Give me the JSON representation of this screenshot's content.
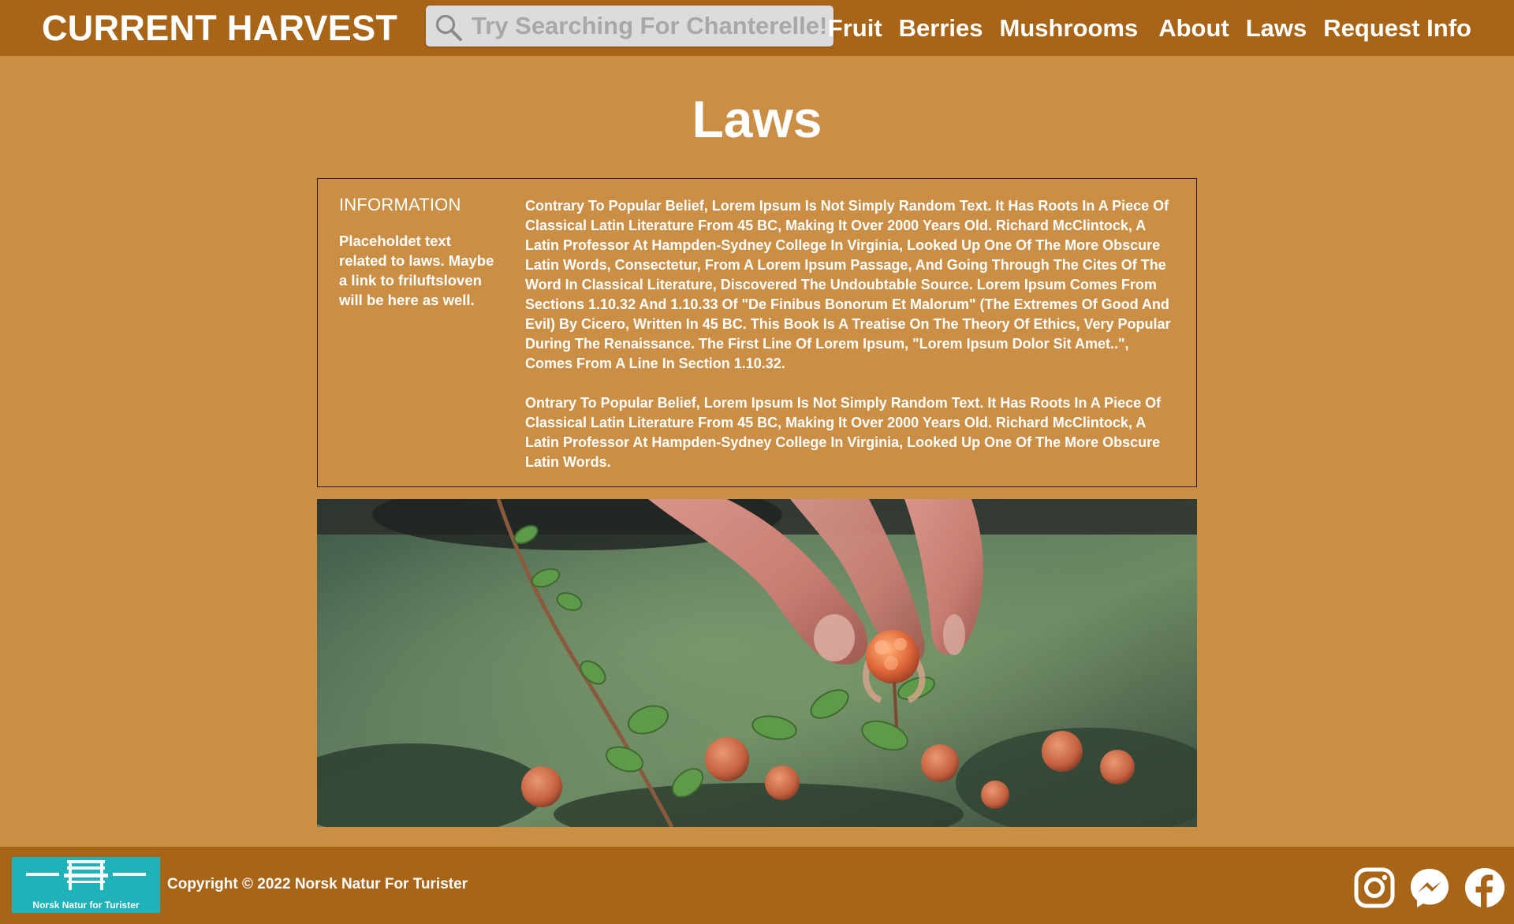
{
  "header": {
    "brand": "CURRENT HARVEST",
    "search": {
      "placeholder": "Try Searching For Chanterelle!",
      "value": ""
    },
    "nav": [
      {
        "label": "Fruit"
      },
      {
        "label": "Berries"
      },
      {
        "label": "Mushrooms"
      },
      {
        "label": "About"
      },
      {
        "label": "Laws"
      },
      {
        "label": "Request Info"
      }
    ]
  },
  "main": {
    "title": "Laws",
    "info": {
      "heading": "INFORMATION",
      "side_text": "Placeholdet text related to laws. Maybe a link to friluftsloven will be here as well.",
      "paragraphs": [
        "Contrary To Popular Belief, Lorem Ipsum Is Not Simply Random Text. It Has Roots In A Piece Of Classical Latin Literature From 45 BC, Making It Over 2000 Years Old. Richard McClintock, A Latin Professor At Hampden-Sydney College In Virginia, Looked Up One Of The More Obscure Latin Words, Consectetur, From A Lorem Ipsum Passage, And Going Through The Cites Of The Word In Classical Literature, Discovered The Undoubtable Source. Lorem Ipsum Comes From Sections 1.10.32 And 1.10.33 Of \"De Finibus Bonorum Et Malorum\" (The Extremes Of Good And Evil) By Cicero, Written In 45 BC. This Book Is A Treatise On The Theory Of Ethics, Very Popular During The Renaissance. The First Line Of Lorem Ipsum, \"Lorem Ipsum Dolor Sit Amet..\", Comes From A Line In Section 1.10.32.",
        "Ontrary To Popular Belief, Lorem Ipsum Is Not Simply Random Text. It Has Roots In A Piece Of Classical Latin Literature From 45 BC, Making It Over 2000 Years Old. Richard McClintock, A Latin Professor At Hampden-Sydney College In Virginia, Looked Up One Of The More Obscure Latin Words."
      ]
    }
  },
  "footer": {
    "logo_text": "Norsk Natur for Turister",
    "copyright": "Copyright © 2022 Norsk Natur For Turister",
    "social_icons": [
      "instagram-icon",
      "messenger-icon",
      "facebook-icon"
    ]
  },
  "colors": {
    "header_bg": "#a86518",
    "page_bg": "#cb8e45",
    "logo_bg": "#1fb2b8",
    "text": "#ffffff"
  }
}
